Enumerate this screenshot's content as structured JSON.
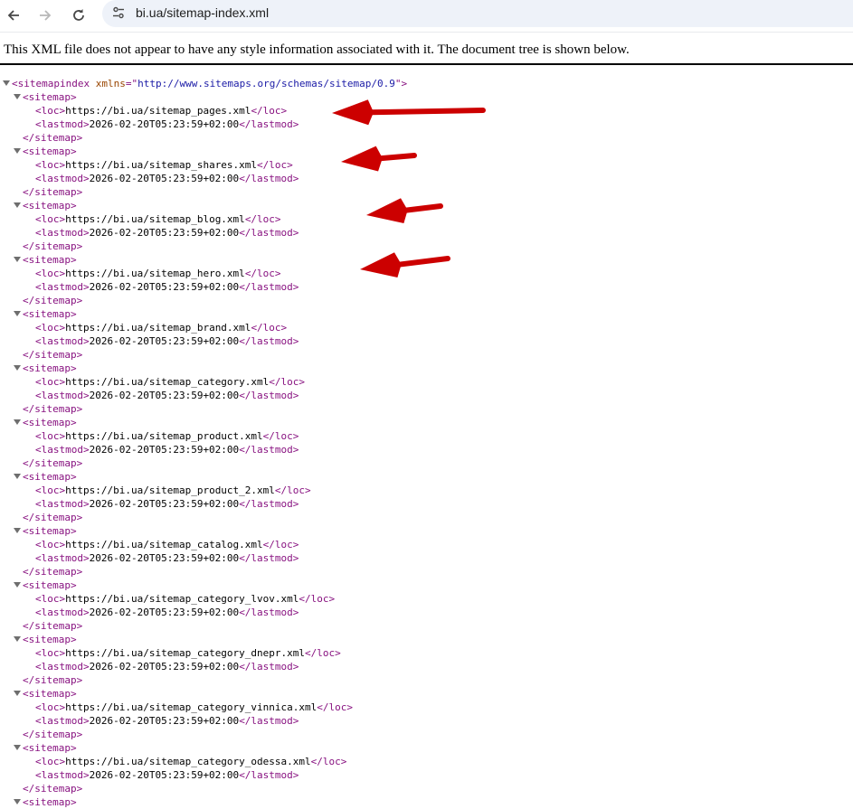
{
  "browser": {
    "back_icon": "arrow-left-icon",
    "forward_icon": "arrow-right-icon",
    "reload_icon": "reload-icon",
    "site_info_icon": "tune-icon",
    "url": "bi.ua/sitemap-index.xml"
  },
  "info_message": "This XML file does not appear to have any style information associated with it. The document tree is shown below.",
  "xml": {
    "root_tag": "sitemapindex",
    "xmlns_attr": "xmlns",
    "xmlns_value": "http://www.sitemaps.org/schemas/sitemap/0.9",
    "entry_tag": "sitemap",
    "loc_tag": "loc",
    "lastmod_tag": "lastmod",
    "entries": [
      {
        "loc": "https://bi.ua/sitemap_pages.xml",
        "lastmod": "2026-02-20T05:23:59+02:00"
      },
      {
        "loc": "https://bi.ua/sitemap_shares.xml",
        "lastmod": "2026-02-20T05:23:59+02:00"
      },
      {
        "loc": "https://bi.ua/sitemap_blog.xml",
        "lastmod": "2026-02-20T05:23:59+02:00"
      },
      {
        "loc": "https://bi.ua/sitemap_hero.xml",
        "lastmod": "2026-02-20T05:23:59+02:00"
      },
      {
        "loc": "https://bi.ua/sitemap_brand.xml",
        "lastmod": "2026-02-20T05:23:59+02:00"
      },
      {
        "loc": "https://bi.ua/sitemap_category.xml",
        "lastmod": "2026-02-20T05:23:59+02:00"
      },
      {
        "loc": "https://bi.ua/sitemap_product.xml",
        "lastmod": "2026-02-20T05:23:59+02:00"
      },
      {
        "loc": "https://bi.ua/sitemap_product_2.xml",
        "lastmod": "2026-02-20T05:23:59+02:00"
      },
      {
        "loc": "https://bi.ua/sitemap_catalog.xml",
        "lastmod": "2026-02-20T05:23:59+02:00"
      },
      {
        "loc": "https://bi.ua/sitemap_category_lvov.xml",
        "lastmod": "2026-02-20T05:23:59+02:00"
      },
      {
        "loc": "https://bi.ua/sitemap_category_dnepr.xml",
        "lastmod": "2026-02-20T05:23:59+02:00"
      },
      {
        "loc": "https://bi.ua/sitemap_category_vinnica.xml",
        "lastmod": "2026-02-20T05:23:59+02:00"
      },
      {
        "loc": "https://bi.ua/sitemap_category_odessa.xml",
        "lastmod": "2026-02-20T05:23:59+02:00"
      }
    ]
  },
  "annotations": {
    "arrow_color": "#cc0000",
    "arrow_icon": "red-arrow-icon",
    "arrow_targets": [
      "https://bi.ua/sitemap_pages.xml",
      "https://bi.ua/sitemap_shares.xml",
      "https://bi.ua/sitemap_blog.xml",
      "https://bi.ua/sitemap_hero.xml"
    ]
  }
}
